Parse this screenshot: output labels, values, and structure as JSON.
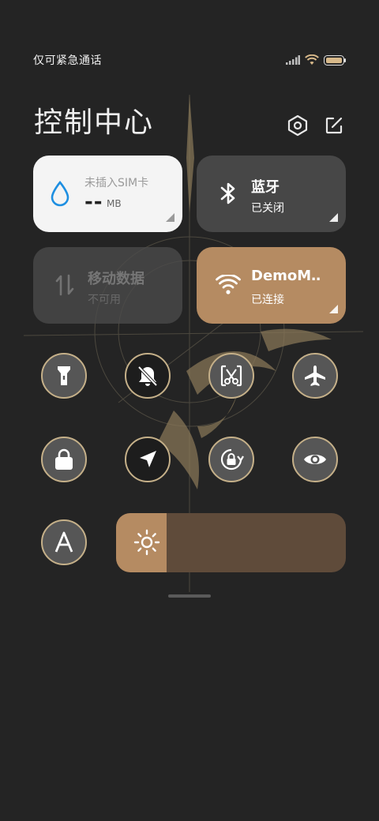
{
  "status_bar": {
    "carrier_text": "仅可紧急通话",
    "icons": [
      "signal-icon",
      "wifi-icon",
      "battery-icon"
    ]
  },
  "header": {
    "title": "控制中心",
    "buttons": [
      "settings-icon",
      "edit-icon"
    ]
  },
  "tiles": {
    "data_usage": {
      "label": "未插入SIM卡",
      "value": "--",
      "unit": "MB",
      "icon": "droplet-icon"
    },
    "bluetooth": {
      "label": "蓝牙",
      "status": "已关闭",
      "icon": "bluetooth-icon"
    },
    "mobile_data": {
      "label": "移动数据",
      "status": "不可用",
      "icon": "data-arrows-icon"
    },
    "wifi": {
      "label": "DemoM‥",
      "status": "已连接",
      "icon": "wifi-icon"
    }
  },
  "toggles": [
    "flashlight-icon",
    "mute-icon",
    "screenshot-icon",
    "airplane-icon",
    "lock-icon",
    "location-icon",
    "rotation-lock-icon",
    "eye-icon",
    "font-icon"
  ],
  "brightness": {
    "level": 0.22,
    "icon": "sun-icon"
  },
  "colors": {
    "accent": "#b58b62",
    "tile_dark": "#474747",
    "ring": "#c5b089"
  }
}
